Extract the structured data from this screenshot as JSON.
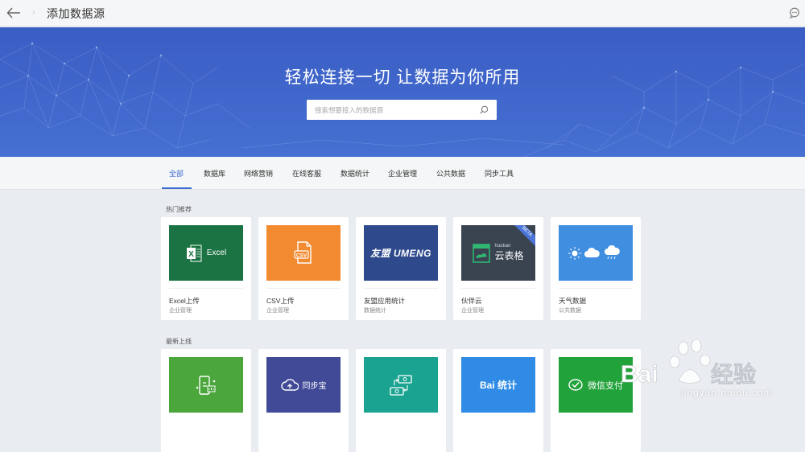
{
  "header": {
    "title": "添加数据源"
  },
  "hero": {
    "title": "轻松连接一切 让数据为你所用",
    "search_placeholder": "搜索想要接入的数据源"
  },
  "tabs": [
    "全部",
    "数据库",
    "网络营销",
    "在线客服",
    "数据统计",
    "企业管理",
    "公共数据",
    "同步工具"
  ],
  "active_tab": "全部",
  "sections": {
    "hot": {
      "label": "热门推荐",
      "cards": [
        {
          "name": "Excel上传",
          "category": "企业管理",
          "thumb_text": "Excel",
          "color": "#1b7343"
        },
        {
          "name": "CSV上传",
          "category": "企业管理",
          "thumb_text": "CSV",
          "color": "#f28a30"
        },
        {
          "name": "友盟应用统计",
          "category": "数据统计",
          "thumb_text": "友盟 UMENG",
          "color": "#2e4a8c"
        },
        {
          "name": "伙伴云",
          "category": "企业管理",
          "thumb_text": "云表格",
          "thumb_sub": "huoban",
          "badge": "BETA",
          "color": "#3a4450"
        },
        {
          "name": "天气数据",
          "category": "公共数据",
          "color": "#3f8ee0"
        }
      ]
    },
    "new": {
      "label": "最新上线",
      "cards": [
        {
          "color": "#4ba63c"
        },
        {
          "thumb_text": "同步宝",
          "color": "#404a96"
        },
        {
          "color": "#1aa391"
        },
        {
          "thumb_text": "Bai 统计",
          "color": "#2f8be6"
        },
        {
          "thumb_text": "微信支付",
          "color": "#22a23a"
        }
      ]
    }
  },
  "watermark": {
    "text": "jingyan.baidu.com"
  }
}
